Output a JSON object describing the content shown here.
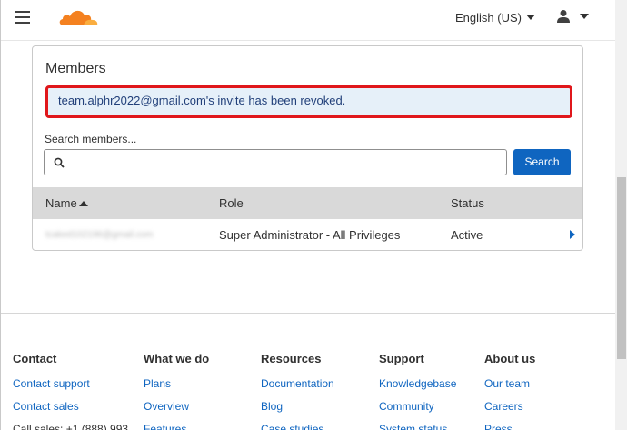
{
  "header": {
    "language": "English (US)",
    "menu_icon": "hamburger-menu-icon",
    "logo_icon": "cloudflare-cloud-logo",
    "user_icon": "user-icon",
    "brand_color": "#f48120"
  },
  "members": {
    "title": "Members",
    "alert_text": "team.alphr2022@gmail.com's invite has been revoked.",
    "search_label": "Search members...",
    "search_value": "",
    "search_button": "Search",
    "columns": [
      "Name",
      "Role",
      "Status"
    ],
    "rows": [
      {
        "name": "tcaked102196@gmail.com",
        "role": "Super Administrator - All Privileges",
        "status": "Active"
      }
    ]
  },
  "footer": {
    "columns": [
      {
        "title": "Contact",
        "links": [
          "Contact support",
          "Contact sales"
        ],
        "text": "Call sales: +1 (888) 993"
      },
      {
        "title": "What we do",
        "links": [
          "Plans",
          "Overview",
          "Features"
        ]
      },
      {
        "title": "Resources",
        "links": [
          "Documentation",
          "Blog",
          "Case studies"
        ]
      },
      {
        "title": "Support",
        "links": [
          "Knowledgebase",
          "Community",
          "System status"
        ]
      },
      {
        "title": "About us",
        "links": [
          "Our team",
          "Careers",
          "Press"
        ]
      }
    ]
  },
  "colors": {
    "accent": "#0f65c0",
    "alert_bg": "#e6f0f9",
    "alert_border": "#e0171b",
    "table_header_bg": "#d9d9d9"
  }
}
